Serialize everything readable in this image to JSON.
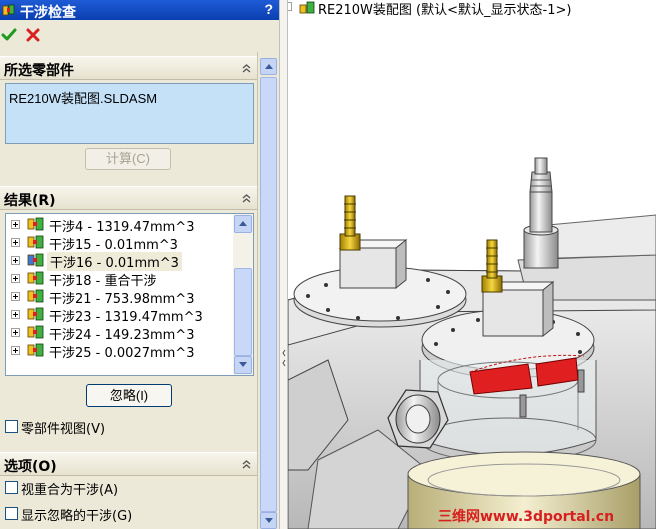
{
  "panel": {
    "title": "干涉检查",
    "help": "?"
  },
  "sections": {
    "selected": {
      "title": "所选零部件"
    },
    "results": {
      "title": "结果(R)"
    },
    "options": {
      "title": "选项(O)"
    }
  },
  "selected_components": [
    "RE210W装配图.SLDASM"
  ],
  "buttons": {
    "calculate": "计算(C)",
    "ignore": "忽略(I)"
  },
  "results": [
    {
      "label": "干涉4 - 1319.47mm^3",
      "selected": false
    },
    {
      "label": "干涉15 - 0.01mm^3",
      "selected": false
    },
    {
      "label": "干涉16 - 0.01mm^3",
      "selected": true
    },
    {
      "label": "干涉18 - 重合干涉",
      "selected": false
    },
    {
      "label": "干涉21 - 753.98mm^3",
      "selected": false
    },
    {
      "label": "干涉23 - 1319.47mm^3",
      "selected": false
    },
    {
      "label": "干涉24 - 149.23mm^3",
      "selected": false
    },
    {
      "label": "干涉25 - 0.0027mm^3",
      "selected": false
    }
  ],
  "checkboxes": {
    "component_view": {
      "label": "零部件视图(V)",
      "checked": false
    },
    "coincidence_as_interference": {
      "label": "视重合为干涉(A)",
      "checked": false
    },
    "show_ignored": {
      "label": "显示忽略的干涉(G)",
      "checked": false
    }
  },
  "graphics": {
    "tree_root": "RE210W装配图  (默认<默认_显示状态-1>)",
    "watermark": "三维网www.3dportal.cn"
  },
  "colors": {
    "title_bar": "#0a3fb0",
    "panel_bg": "#ece9d8",
    "list_selected_bg": "#c4e1f8",
    "interference_red": "#e02020"
  }
}
